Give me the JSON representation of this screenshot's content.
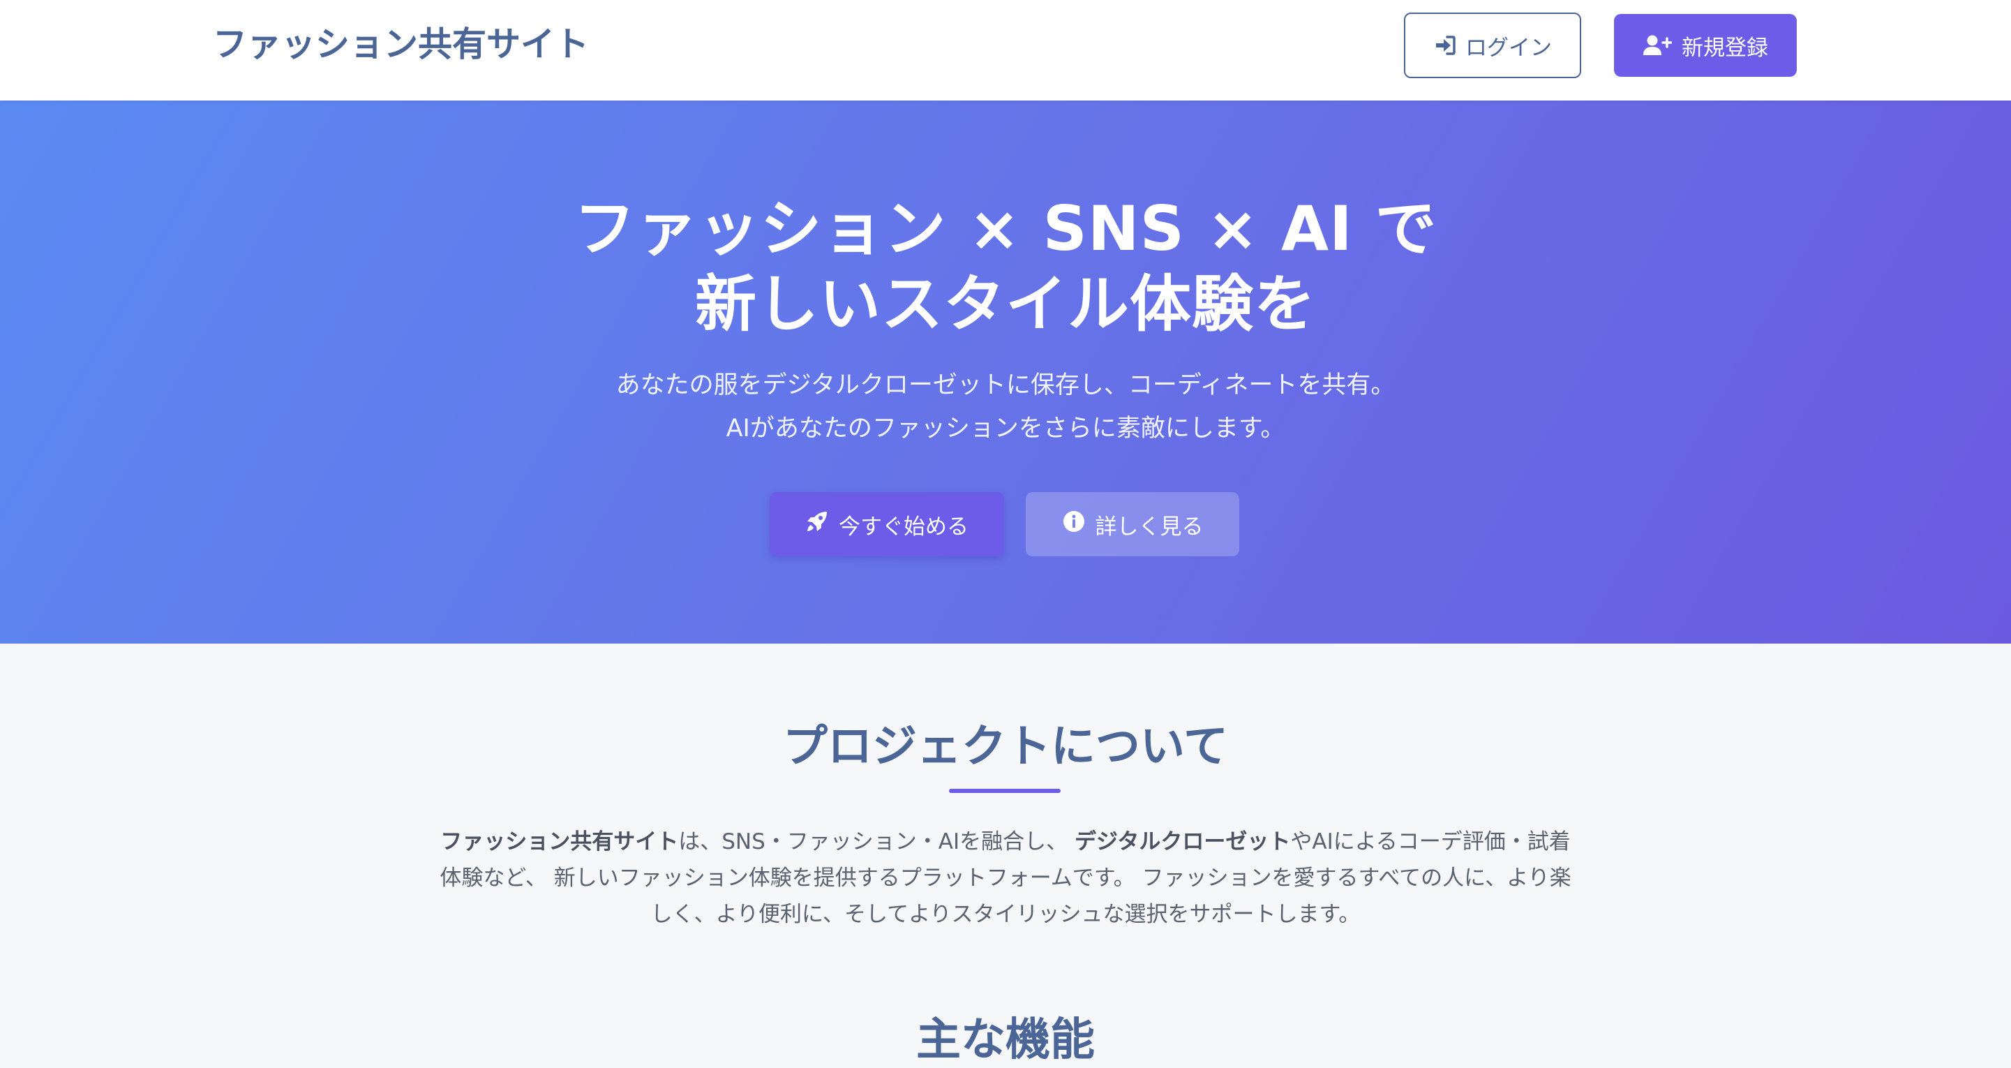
{
  "header": {
    "brand": "ファッション共有サイト",
    "login_label": "ログイン",
    "register_label": "新規登録"
  },
  "hero": {
    "title_line1": "ファッション × SNS × AI で",
    "title_line2": "新しいスタイル体験を",
    "subtitle_line1": "あなたの服をデジタルクローゼットに保存し、コーディネートを共有。",
    "subtitle_line2": "AIがあなたのファッションをさらに素敵にします。",
    "start_label": "今すぐ始める",
    "more_label": "詳しく見る"
  },
  "about": {
    "title": "プロジェクトについて",
    "text_1_bold": "ファッション共有サイト",
    "text_2": "は、SNS・ファッション・AIを融合し、",
    "text_3_bold": "デジタルクローゼット",
    "text_4": "やAIによるコーデ評価・試着体験など、 新しいファッション体験を提供するプラットフォームです。 ファッションを愛するすべての人に、より楽しく、より便利に、そしてよりスタイリッシュな選択をサポートします。"
  },
  "features": {
    "title": "主な機能"
  },
  "colors": {
    "brand": "#4a6596",
    "accent": "#6c5ce7",
    "hero_gradient_start": "#5b8af3",
    "hero_gradient_end": "#6b5ae0"
  },
  "icons": {
    "login": "sign-in-icon",
    "register": "user-plus-icon",
    "start": "rocket-icon",
    "more": "info-circle-icon"
  }
}
